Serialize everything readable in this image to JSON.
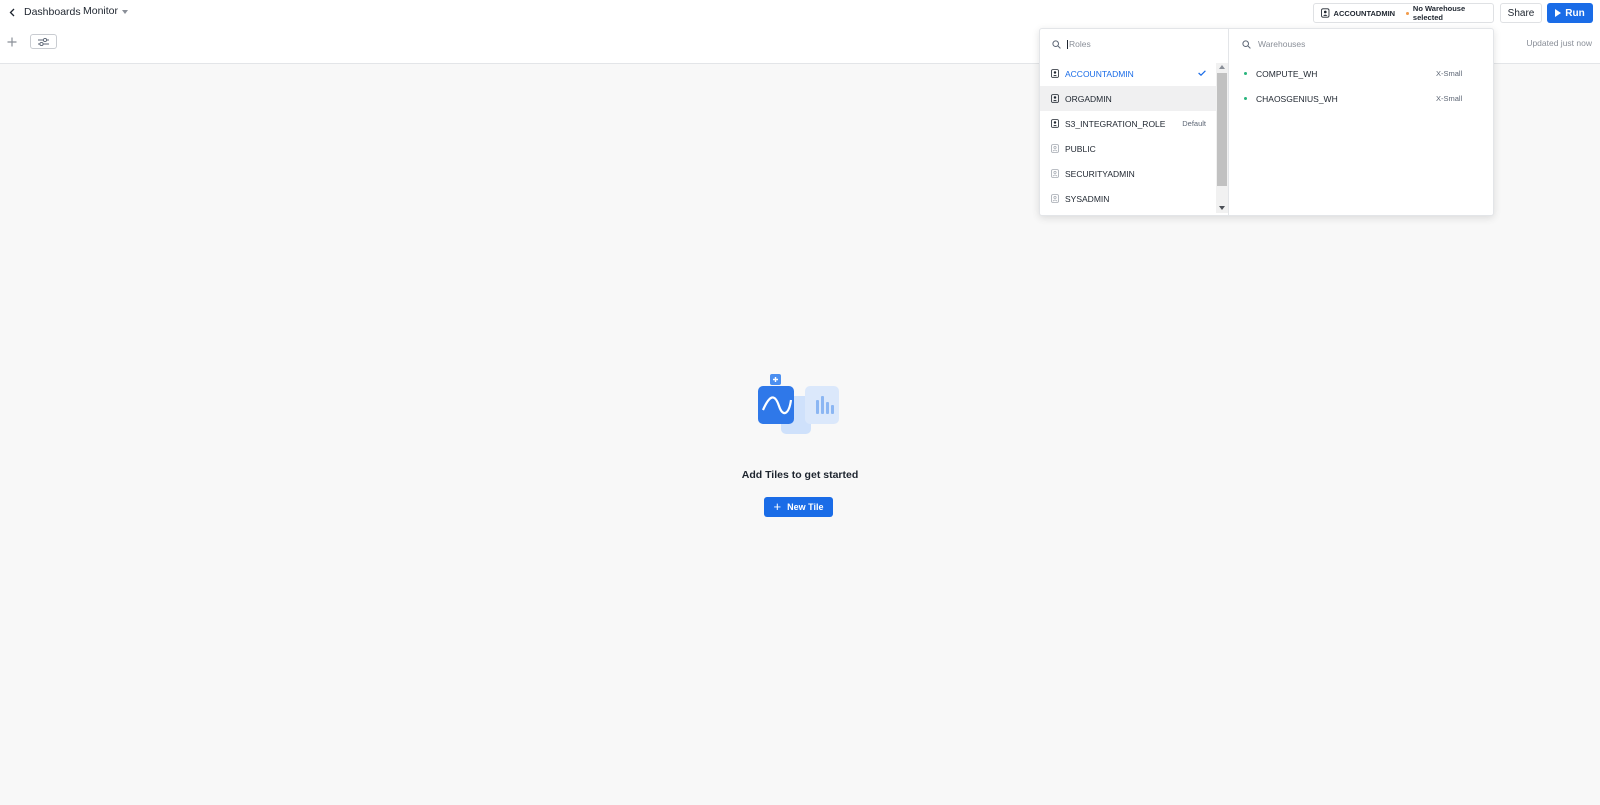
{
  "header": {
    "breadcrumb": "Dashboards",
    "dashboard_name": "Monitor",
    "context_role": "ACCOUNTADMIN",
    "context_warehouse": "No Warehouse selected",
    "share_label": "Share",
    "run_label": "Run",
    "updated_text": "Updated just now"
  },
  "dropdown": {
    "roles_placeholder": "Roles",
    "warehouses_placeholder": "Warehouses",
    "roles": [
      {
        "name": "ACCOUNTADMIN",
        "selected": true,
        "note": ""
      },
      {
        "name": "ORGADMIN",
        "selected": false,
        "note": ""
      },
      {
        "name": "S3_INTEGRATION_ROLE",
        "selected": false,
        "note": "Default"
      },
      {
        "name": "PUBLIC",
        "selected": false,
        "note": ""
      },
      {
        "name": "SECURITYADMIN",
        "selected": false,
        "note": ""
      },
      {
        "name": "SYSADMIN",
        "selected": false,
        "note": ""
      }
    ],
    "warehouses": [
      {
        "name": "COMPUTE_WH",
        "size": "X-Small"
      },
      {
        "name": "CHAOSGENIUS_WH",
        "size": "X-Small"
      }
    ]
  },
  "empty_state": {
    "title": "Add Tiles to get started",
    "button_label": "New Tile"
  },
  "colors": {
    "accent": "#1a6ce7",
    "warehouse_status": "#29b57d",
    "no_warehouse_dot": "#f29b4a"
  }
}
